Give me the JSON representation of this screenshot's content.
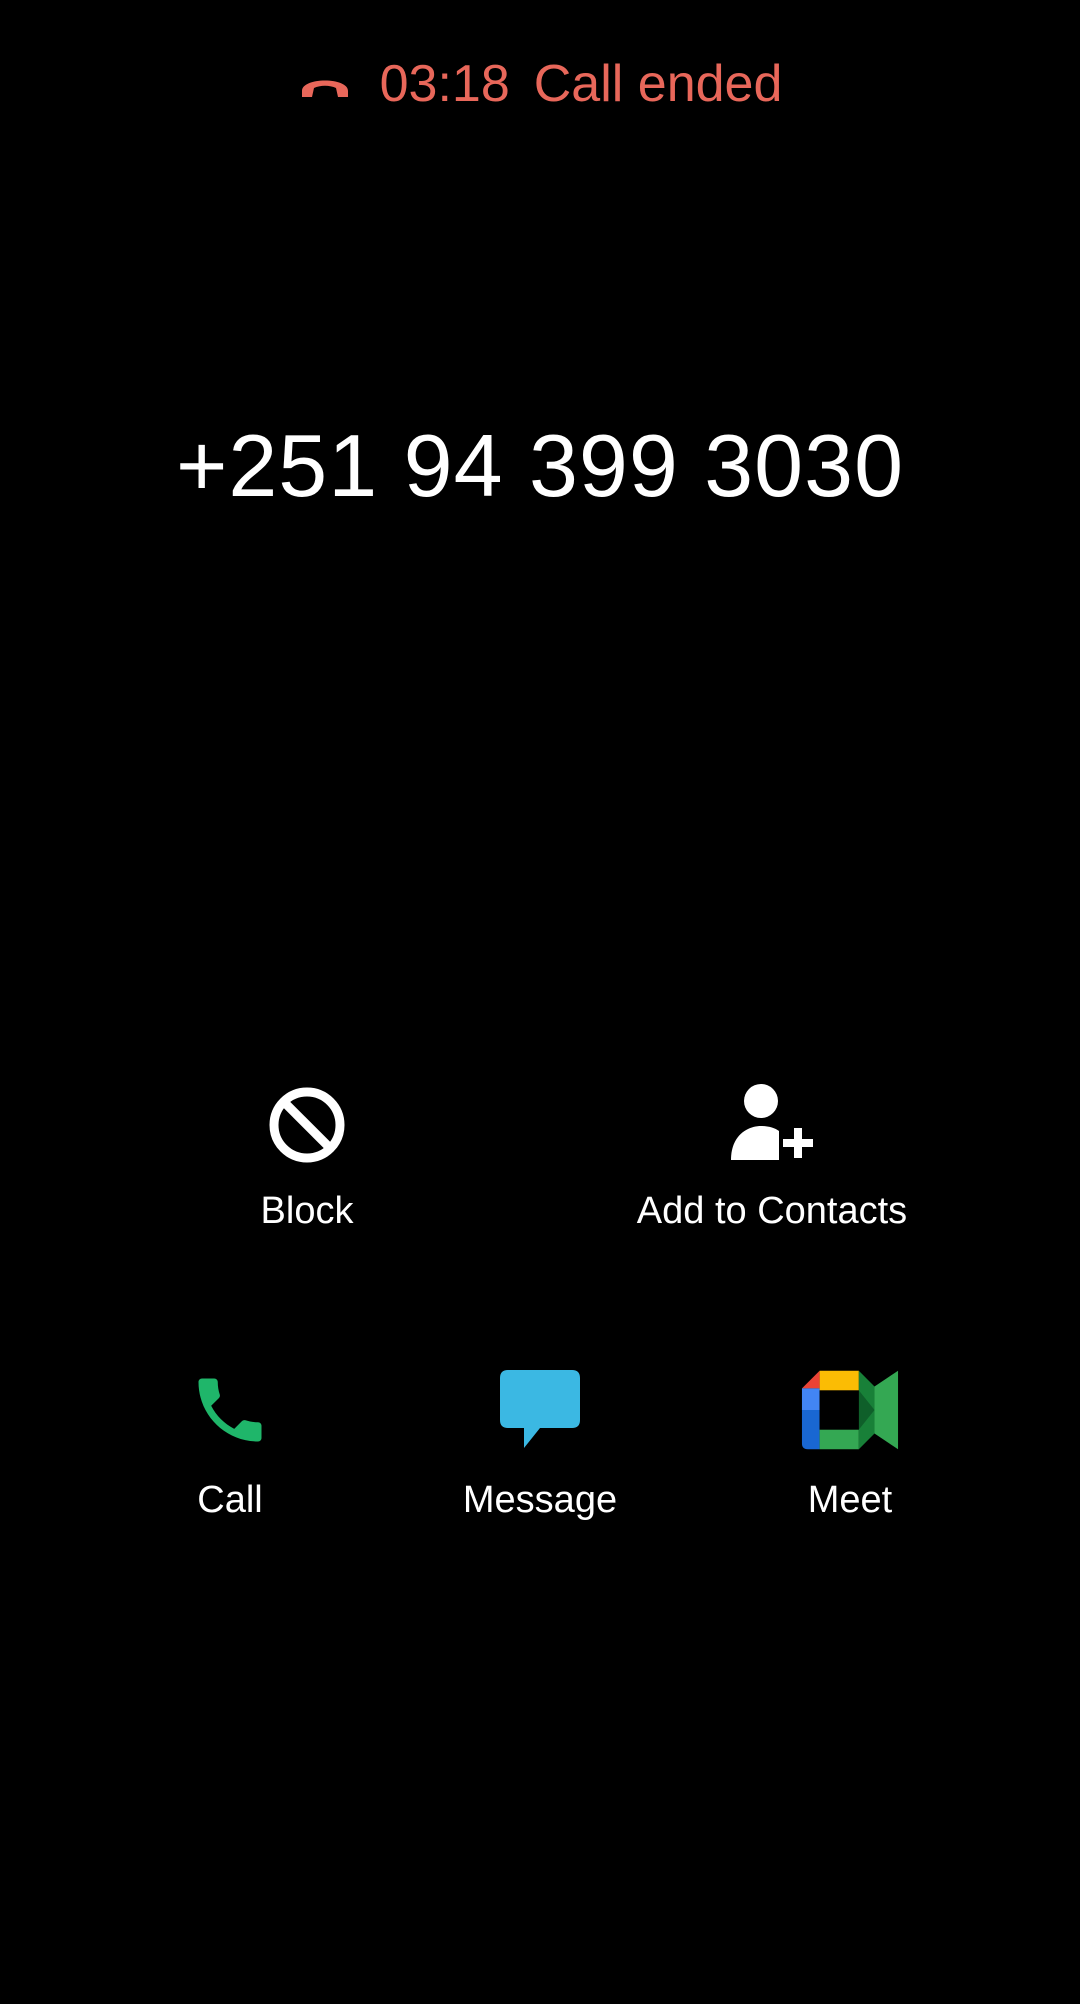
{
  "status": {
    "duration": "03:18",
    "text": "Call ended",
    "color": "#e8675a",
    "icon": "call-end-icon"
  },
  "caller": {
    "number": "+251 94 399 3030"
  },
  "actions": {
    "block": {
      "label": "Block",
      "icon": "block-icon"
    },
    "add_contact": {
      "label": "Add to Contacts",
      "icon": "add-person-icon"
    }
  },
  "bottom_actions": {
    "call": {
      "label": "Call",
      "icon": "phone-icon",
      "color": "#1fb66a"
    },
    "message": {
      "label": "Message",
      "icon": "message-bubble-icon",
      "color": "#3bb8e3"
    },
    "meet": {
      "label": "Meet",
      "icon": "google-meet-icon"
    }
  }
}
